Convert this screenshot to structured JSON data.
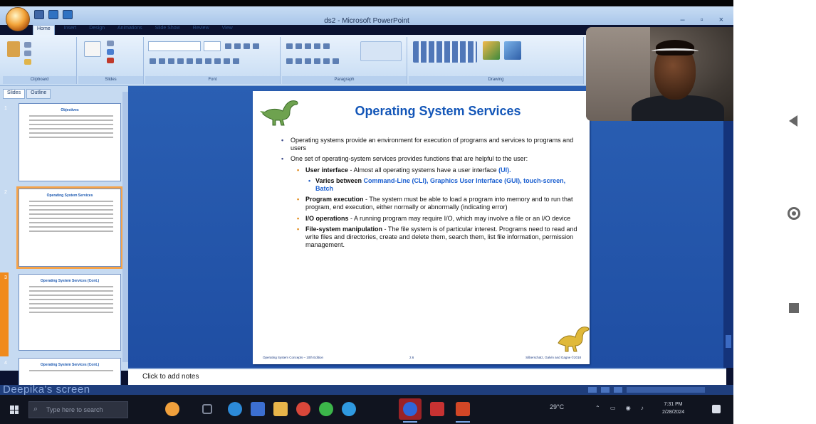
{
  "window": {
    "title": "ds2 - Microsoft PowerPoint",
    "controls": [
      "–",
      "▫",
      "×"
    ]
  },
  "ribbon": {
    "tabs": [
      "Home",
      "Insert",
      "Design",
      "Animations",
      "Slide Show",
      "Review",
      "View"
    ],
    "groups": [
      "Clipboard",
      "Slides",
      "Font",
      "Paragraph",
      "Drawing"
    ]
  },
  "slide_panel": {
    "tabs": [
      "Slides",
      "Outline"
    ],
    "thumbnails": [
      {
        "number": "1",
        "title": "Objectives"
      },
      {
        "number": "2",
        "title": "Operating System Services"
      },
      {
        "number": "3",
        "title": "Operating System Services (Cont.)"
      },
      {
        "number": "4",
        "title": "Operating System Services (Cont.)"
      }
    ]
  },
  "slide": {
    "title": "Operating System Services",
    "bullets": {
      "b1": "Operating systems provide an environment for execution of programs and services to programs and users",
      "b2": "One set of operating-system services provides functions that are helpful to the user:",
      "ui_term": "User interface",
      "ui_text": " - Almost all operating systems have a user interface ",
      "ui_abbr": "(UI).",
      "varies_prefix": "Varies between ",
      "varies_text": "Command-Line (CLI), Graphics User Interface (GUI), touch-screen, Batch",
      "prog_term": "Program execution",
      "prog_text": " - The system must be able to load a program into memory and to run that program, end execution, either normally or abnormally (indicating error)",
      "io_term": "I/O operations",
      "io_text": " - A running program may require I/O, which may involve a file or an I/O device",
      "fs_term": "File-system manipulation",
      "fs_text": " - The file system is of particular interest. Programs need to read and write files and directories, create and delete them, search them, list file information, permission management."
    },
    "footer": {
      "left": "Operating System Concepts – 10th Edition",
      "middle": "2.6",
      "right": "Silberschatz, Galvin and Gagne ©2018"
    }
  },
  "notes": {
    "placeholder": "Click to add notes"
  },
  "status": {
    "overlay": "Deepika's screen"
  },
  "taskbar": {
    "search_placeholder": "Type here to search",
    "weather": "29°C",
    "clock_time": "7:31 PM",
    "clock_date": "2/28/2024"
  },
  "colors": {
    "slide_title": "#1356b8",
    "accent_blue": "#1a5fd0",
    "canvas": "#2a5fb3",
    "selection": "#f5a34a"
  },
  "icons": [
    "office-button-icon",
    "dinosaur-icon",
    "windows-start-icon",
    "search-icon",
    "back-icon",
    "home-icon",
    "recents-icon"
  ]
}
